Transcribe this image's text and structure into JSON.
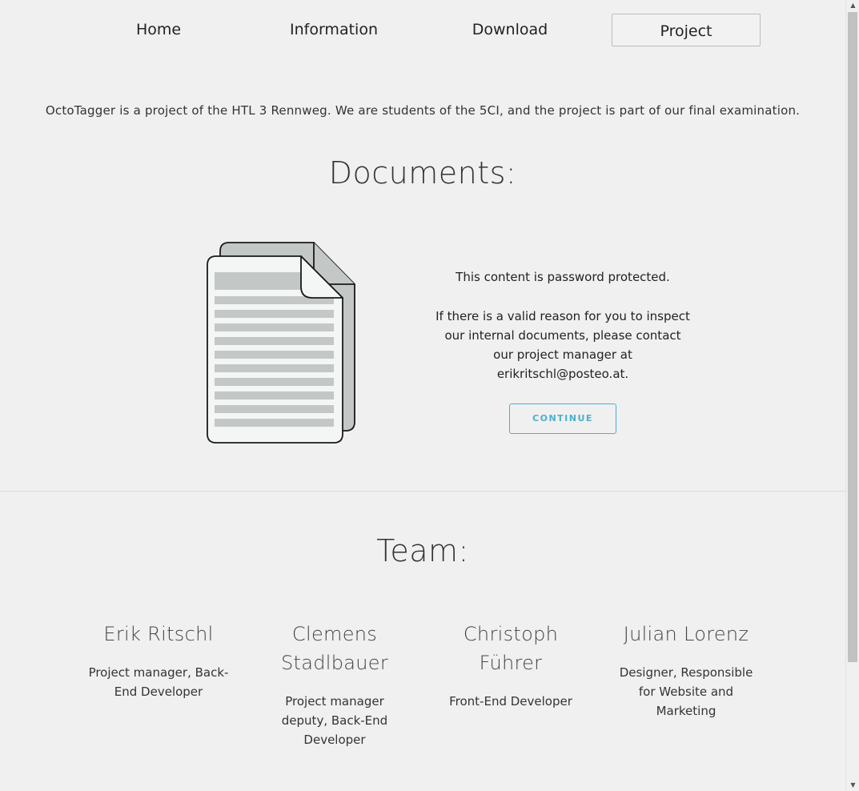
{
  "nav": {
    "items": [
      {
        "label": "Home",
        "active": false
      },
      {
        "label": "Information",
        "active": false
      },
      {
        "label": "Download",
        "active": false
      },
      {
        "label": "Project",
        "active": true
      }
    ]
  },
  "intro": "OctoTagger is a project of the HTL 3 Rennweg. We are students of the 5CI, and the project is part of our final examination.",
  "documents": {
    "title": "Documents:",
    "icon": "document-icon",
    "protected_text": "This content is password protected.",
    "contact_line1": "If there is a valid reason for you to inspect",
    "contact_line2": "our internal documents, please contact",
    "contact_line3": "our project manager at",
    "email": "erikritschl@posteo.at.",
    "continue_label": "CONTINUE"
  },
  "team": {
    "title": "Team:",
    "members": [
      {
        "name": "Erik Ritschl",
        "role": "Project manager, Back-End Developer"
      },
      {
        "name": "Clemens Stadlbauer",
        "role": "Project manager deputy, Back-End Developer"
      },
      {
        "name": "Christoph Führer",
        "role": "Front-End Developer"
      },
      {
        "name": "Julian Lorenz",
        "role": "Designer, Responsible for Website and Marketing"
      }
    ]
  },
  "colors": {
    "accent": "#4ab0cc",
    "background": "#f0f0f0"
  }
}
